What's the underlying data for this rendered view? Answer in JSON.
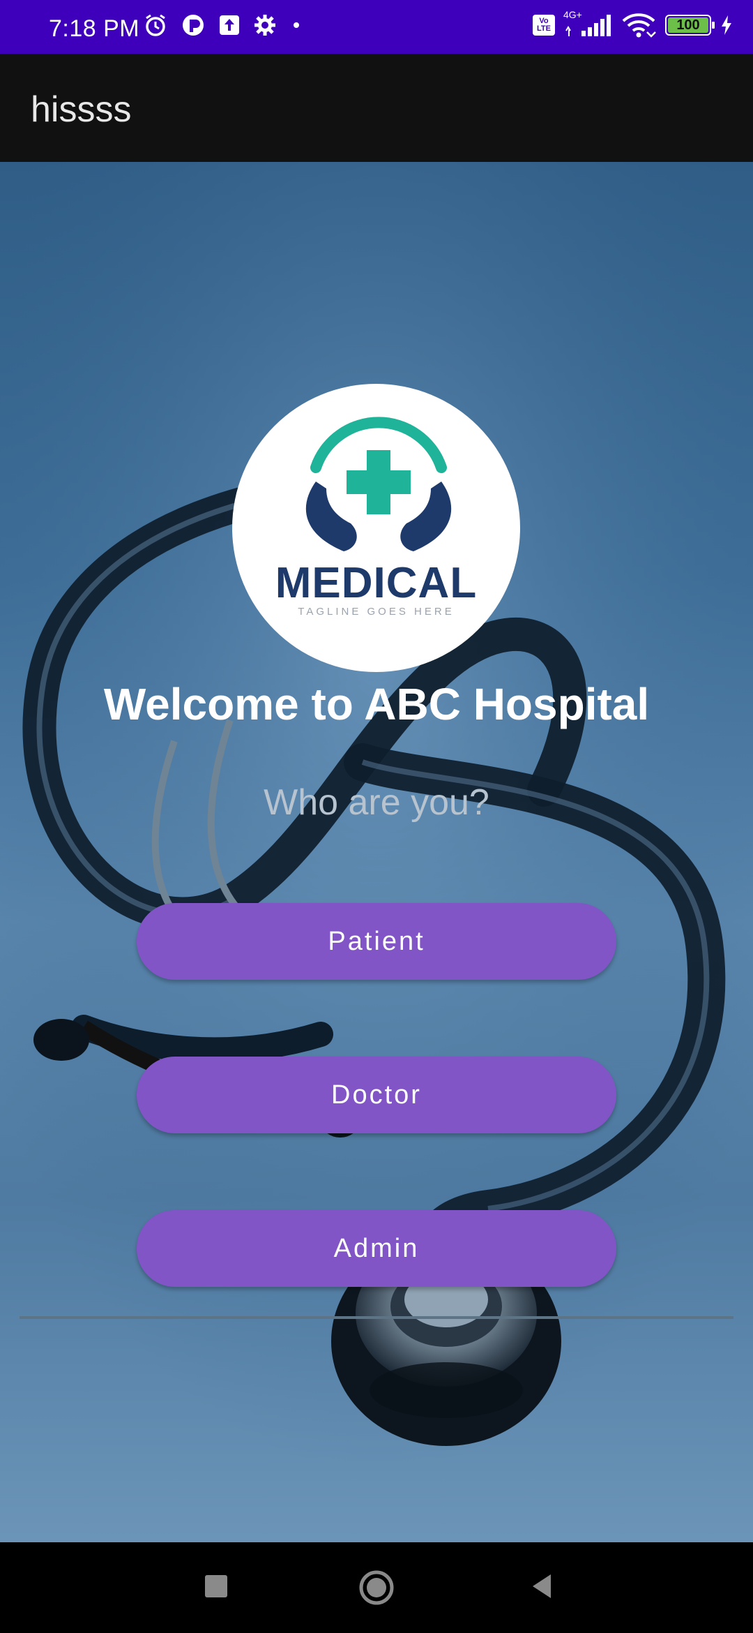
{
  "status_bar": {
    "time": "7:18 PM",
    "network_label_top": "Vo",
    "network_label_bottom": "LTE",
    "network_type": "4G+",
    "battery": "100",
    "icons": [
      "alarm-icon",
      "app-icon",
      "upload-icon",
      "settings-icon",
      "dot-icon",
      "volte-icon",
      "signal-icon",
      "wifi-icon",
      "battery-icon",
      "charging-icon"
    ]
  },
  "app_bar": {
    "title": "hissss"
  },
  "logo": {
    "word": "MEDICAL",
    "tagline": "TAGLINE GOES HERE",
    "icon": "medical-cross-hands-icon"
  },
  "main": {
    "welcome": "Welcome to ABC Hospital",
    "question": "Who are you?",
    "buttons": [
      {
        "label": "Patient"
      },
      {
        "label": "Doctor"
      },
      {
        "label": "Admin"
      }
    ]
  },
  "nav_bar": {
    "icons": [
      "recents-icon",
      "home-icon",
      "back-icon"
    ]
  },
  "colors": {
    "status_bar": "#3f00bb",
    "app_bar": "#111111",
    "button": "#8155c6",
    "logo_teal": "#1fb39a",
    "logo_navy": "#1d3a6b"
  }
}
